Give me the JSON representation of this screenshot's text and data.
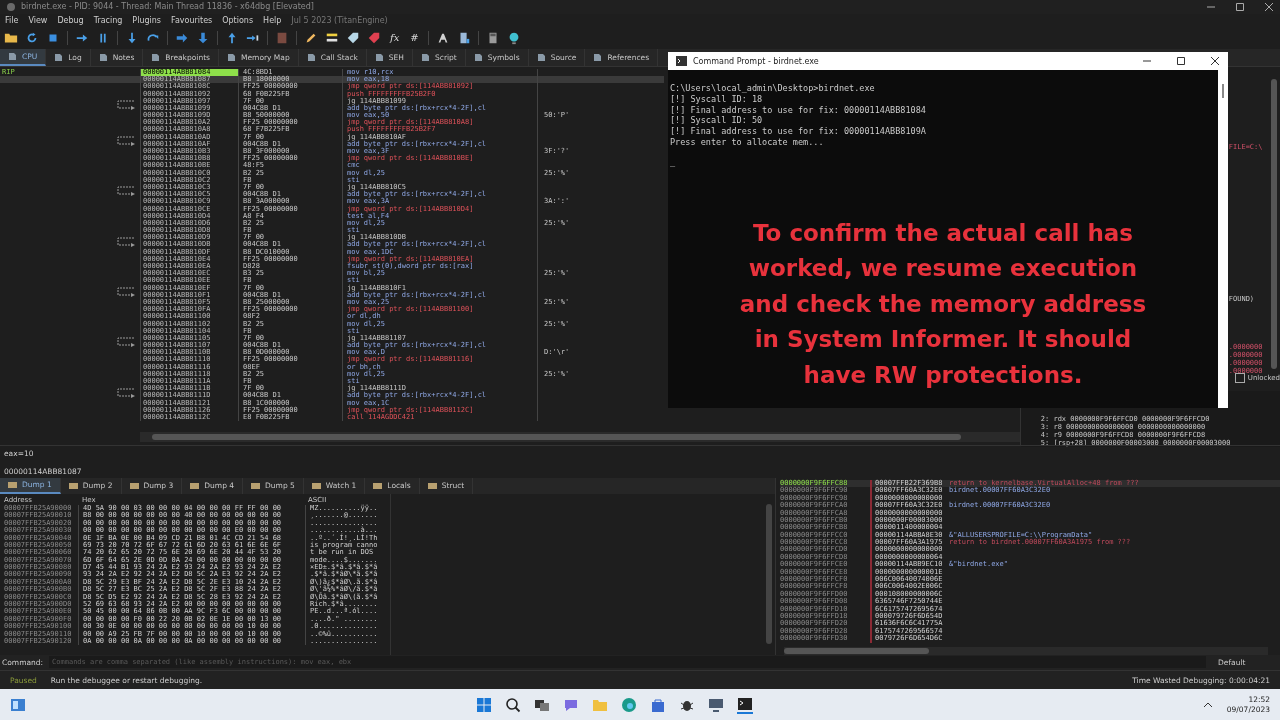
{
  "window": {
    "title": "birdnet.exe - PID: 9044 - Thread: Main Thread 11836 - x64dbg [Elevated]"
  },
  "menu": [
    "File",
    "View",
    "Debug",
    "Tracing",
    "Plugins",
    "Favourites",
    "Options",
    "Help"
  ],
  "build_info": "Jul 5 2023 (TitanEngine)",
  "toolbar": [
    {
      "kind": "folder"
    },
    {
      "kind": "restart"
    },
    {
      "kind": "stop"
    },
    {
      "kind": "separator"
    },
    {
      "kind": "run"
    },
    {
      "kind": "pause"
    },
    {
      "kind": "separator"
    },
    {
      "kind": "step-into"
    },
    {
      "kind": "step-over"
    },
    {
      "kind": "separator"
    },
    {
      "kind": "trace-into"
    },
    {
      "kind": "trace-over"
    },
    {
      "kind": "separator"
    },
    {
      "kind": "execute-till-return"
    },
    {
      "kind": "run-to-user"
    },
    {
      "kind": "separator"
    },
    {
      "kind": "brick"
    },
    {
      "kind": "separator"
    },
    {
      "kind": "pencil"
    },
    {
      "kind": "comment"
    },
    {
      "kind": "label"
    },
    {
      "kind": "bookmark"
    },
    {
      "kind": "text",
      "label": "fx"
    },
    {
      "kind": "text",
      "label": "#"
    },
    {
      "kind": "separator"
    },
    {
      "kind": "font"
    },
    {
      "kind": "device"
    },
    {
      "kind": "separator"
    },
    {
      "kind": "calculator"
    },
    {
      "kind": "globe"
    }
  ],
  "tabs": [
    {
      "label": "CPU",
      "selected": true
    },
    {
      "label": "Log",
      "selected": false
    },
    {
      "label": "Notes",
      "selected": false
    },
    {
      "label": "Breakpoints",
      "selected": false
    },
    {
      "label": "Memory Map",
      "selected": false
    },
    {
      "label": "Call Stack",
      "selected": false
    },
    {
      "label": "SEH",
      "selected": false
    },
    {
      "label": "Script",
      "selected": false
    },
    {
      "label": "Symbols",
      "selected": false
    },
    {
      "label": "Source",
      "selected": false
    },
    {
      "label": "References",
      "selected": false
    }
  ],
  "disassembly": {
    "rip_label": "RIP",
    "rows": [
      {
        "address": "00000114ABB81084",
        "bytes": "4C:8BD1",
        "instruction": "mov r10,rcx",
        "kind": "plain",
        "rip": true,
        "selected": false
      },
      {
        "address": "00000114ABB81087",
        "bytes": "B8 18000000",
        "instruction": "mov eax,18",
        "kind": "plain",
        "rip": false,
        "selected": true
      },
      {
        "address": "00000114ABB8108C",
        "bytes": "FF25 00000000",
        "instruction": "jmp qword ptr ds:[114ABB81092]",
        "kind": "branch",
        "rip": false,
        "selected": false
      },
      {
        "address": "00000114ABB81092",
        "bytes": "68 F0B225FB",
        "instruction": "push FFFFFFFFFB25B2F0",
        "kind": "branch",
        "rip": false,
        "selected": false
      },
      {
        "address": "00000114ABB81097",
        "bytes": "7F 00",
        "instruction": "jg 114ABB81099",
        "kind": "cond",
        "rip": false,
        "selected": false
      },
      {
        "address": "00000114ABB81099",
        "bytes": "004C8B D1",
        "instruction": "add byte ptr ds:[rbx+rcx*4-2F],cl",
        "kind": "plain",
        "rip": false,
        "selected": false
      },
      {
        "address": "00000114ABB8109D",
        "bytes": "B8 50000000",
        "instruction": "mov eax,50",
        "comment": "50:'P'",
        "kind": "plain",
        "rip": false,
        "selected": false
      },
      {
        "address": "00000114ABB810A2",
        "bytes": "FF25 00000000",
        "instruction": "jmp qword ptr ds:[114ABB810A8]",
        "kind": "branch",
        "rip": false,
        "selected": false
      },
      {
        "address": "00000114ABB810A8",
        "bytes": "68 F7B225FB",
        "instruction": "push FFFFFFFFFB25B2F7",
        "kind": "branch",
        "rip": false,
        "selected": false
      },
      {
        "address": "00000114ABB810AD",
        "bytes": "7F 00",
        "instruction": "jg 114ABB810AF",
        "kind": "cond",
        "rip": false,
        "selected": false
      },
      {
        "address": "00000114ABB810AF",
        "bytes": "004C8B D1",
        "instruction": "add byte ptr ds:[rbx+rcx*4-2F],cl",
        "kind": "plain",
        "rip": false,
        "selected": false
      },
      {
        "address": "00000114ABB810B3",
        "bytes": "B8 3F000000",
        "instruction": "mov eax,3F",
        "comment": "3F:'?'",
        "kind": "plain",
        "rip": false,
        "selected": false
      },
      {
        "address": "00000114ABB810B8",
        "bytes": "FF25 00000000",
        "instruction": "jmp qword ptr ds:[114ABB810BE]",
        "kind": "branch",
        "rip": false,
        "selected": false
      },
      {
        "address": "00000114ABB810BE",
        "bytes": "48:F5",
        "instruction": "cmc",
        "kind": "plain",
        "rip": false,
        "selected": false
      },
      {
        "address": "00000114ABB810C0",
        "bytes": "B2 25",
        "instruction": "mov dl,25",
        "comment": "25:'%'",
        "kind": "plain",
        "rip": false,
        "selected": false
      },
      {
        "address": "00000114ABB810C2",
        "bytes": "FB",
        "instruction": "sti",
        "kind": "plain",
        "rip": false,
        "selected": false
      },
      {
        "address": "00000114ABB810C3",
        "bytes": "7F 00",
        "instruction": "jg 114ABB810C5",
        "kind": "cond",
        "rip": false,
        "selected": false
      },
      {
        "address": "00000114ABB810C5",
        "bytes": "004C8B D1",
        "instruction": "add byte ptr ds:[rbx+rcx*4-2F],cl",
        "kind": "plain",
        "rip": false,
        "selected": false
      },
      {
        "address": "00000114ABB810C9",
        "bytes": "B8 3A000000",
        "instruction": "mov eax,3A",
        "comment": "3A:':'",
        "kind": "plain",
        "rip": false,
        "selected": false
      },
      {
        "address": "00000114ABB810CE",
        "bytes": "FF25 00000000",
        "instruction": "jmp qword ptr ds:[114ABB810D4]",
        "kind": "branch",
        "rip": false,
        "selected": false
      },
      {
        "address": "00000114ABB810D4",
        "bytes": "A8 F4",
        "instruction": "test al,F4",
        "kind": "plain",
        "rip": false,
        "selected": false
      },
      {
        "address": "00000114ABB810D6",
        "bytes": "B2 25",
        "instruction": "mov dl,25",
        "comment": "25:'%'",
        "kind": "plain",
        "rip": false,
        "selected": false
      },
      {
        "address": "00000114ABB810D8",
        "bytes": "FB",
        "instruction": "sti",
        "kind": "plain",
        "rip": false,
        "selected": false
      },
      {
        "address": "00000114ABB810D9",
        "bytes": "7F 00",
        "instruction": "jg 114ABB810DB",
        "kind": "cond",
        "rip": false,
        "selected": false
      },
      {
        "address": "00000114ABB810DB",
        "bytes": "004C8B D1",
        "instruction": "add byte ptr ds:[rbx+rcx*4-2F],cl",
        "kind": "plain",
        "rip": false,
        "selected": false
      },
      {
        "address": "00000114ABB810DF",
        "bytes": "B8 DC010000",
        "instruction": "mov eax,1DC",
        "kind": "plain",
        "rip": false,
        "selected": false
      },
      {
        "address": "00000114ABB810E4",
        "bytes": "FF25 00000000",
        "instruction": "jmp qword ptr ds:[114ABB810EA]",
        "kind": "branch",
        "rip": false,
        "selected": false
      },
      {
        "address": "00000114ABB810EA",
        "bytes": "D828",
        "instruction": "fsubr st(0),dword ptr ds:[rax]",
        "kind": "plain",
        "rip": false,
        "selected": false
      },
      {
        "address": "00000114ABB810EC",
        "bytes": "B3 25",
        "instruction": "mov bl,25",
        "comment": "25:'%'",
        "kind": "plain",
        "rip": false,
        "selected": false
      },
      {
        "address": "00000114ABB810EE",
        "bytes": "FB",
        "instruction": "sti",
        "kind": "plain",
        "rip": false,
        "selected": false
      },
      {
        "address": "00000114ABB810EF",
        "bytes": "7F 00",
        "instruction": "jg 114ABB810F1",
        "kind": "cond",
        "rip": false,
        "selected": false
      },
      {
        "address": "00000114ABB810F1",
        "bytes": "004C8B D1",
        "instruction": "add byte ptr ds:[rbx+rcx*4-2F],cl",
        "kind": "plain",
        "rip": false,
        "selected": false
      },
      {
        "address": "00000114ABB810F5",
        "bytes": "B8 25000000",
        "instruction": "mov eax,25",
        "comment": "25:'%'",
        "kind": "plain",
        "rip": false,
        "selected": false
      },
      {
        "address": "00000114ABB810FA",
        "bytes": "FF25 00000000",
        "instruction": "jmp qword ptr ds:[114ABB81100]",
        "kind": "branch",
        "rip": false,
        "selected": false
      },
      {
        "address": "00000114ABB81100",
        "bytes": "08F2",
        "instruction": "or dl,dh",
        "kind": "plain",
        "rip": false,
        "selected": false
      },
      {
        "address": "00000114ABB81102",
        "bytes": "B2 25",
        "instruction": "mov dl,25",
        "comment": "25:'%'",
        "kind": "plain",
        "rip": false,
        "selected": false
      },
      {
        "address": "00000114ABB81104",
        "bytes": "FB",
        "instruction": "sti",
        "kind": "plain",
        "rip": false,
        "selected": false
      },
      {
        "address": "00000114ABB81105",
        "bytes": "7F 00",
        "instruction": "jg 114ABB81107",
        "kind": "cond",
        "rip": false,
        "selected": false
      },
      {
        "address": "00000114ABB81107",
        "bytes": "004C8B D1",
        "instruction": "add byte ptr ds:[rbx+rcx*4-2F],cl",
        "kind": "plain",
        "rip": false,
        "selected": false
      },
      {
        "address": "00000114ABB8110B",
        "bytes": "B8 0D000000",
        "instruction": "mov eax,D",
        "comment": "D:'\\r'",
        "kind": "plain",
        "rip": false,
        "selected": false
      },
      {
        "address": "00000114ABB81110",
        "bytes": "FF25 00000000",
        "instruction": "jmp qword ptr ds:[114ABB81116]",
        "kind": "branch",
        "rip": false,
        "selected": false
      },
      {
        "address": "00000114ABB81116",
        "bytes": "08EF",
        "instruction": "or bh,ch",
        "kind": "plain",
        "rip": false,
        "selected": false
      },
      {
        "address": "00000114ABB81118",
        "bytes": "B2 25",
        "instruction": "mov dl,25",
        "comment": "25:'%'",
        "kind": "plain",
        "rip": false,
        "selected": false
      },
      {
        "address": "00000114ABB8111A",
        "bytes": "FB",
        "instruction": "sti",
        "kind": "plain",
        "rip": false,
        "selected": false
      },
      {
        "address": "00000114ABB8111B",
        "bytes": "7F 00",
        "instruction": "jg 114ABB8111D",
        "kind": "cond",
        "rip": false,
        "selected": false
      },
      {
        "address": "00000114ABB8111D",
        "bytes": "004C8B D1",
        "instruction": "add byte ptr ds:[rbx+rcx*4-2F],cl",
        "kind": "plain",
        "rip": false,
        "selected": false
      },
      {
        "address": "00000114ABB81121",
        "bytes": "B8 1C000000",
        "instruction": "mov eax,1C",
        "kind": "plain",
        "rip": false,
        "selected": false
      },
      {
        "address": "00000114ABB81126",
        "bytes": "FF25 00000000",
        "instruction": "jmp qword ptr ds:[114ABB8112C]",
        "kind": "branch",
        "rip": false,
        "selected": false
      },
      {
        "address": "00000114ABB8112C",
        "bytes": "E8 F0B225FB",
        "instruction": "call 114AGDDC421",
        "kind": "branch",
        "rip": false,
        "selected": false
      }
    ]
  },
  "registers": {
    "texts": [
      {
        "text": "FILE=C:\\",
        "kind": "red"
      },
      {
        "text": "FOUND)",
        "kind": "plain"
      },
      {
        "text": ".0000000",
        "kind": "red"
      },
      {
        "text": ".0000000",
        "kind": "red"
      },
      {
        "text": ".0000000",
        "kind": "red"
      },
      {
        "text": ".0000000",
        "kind": "red"
      }
    ],
    "lock_label": "Unlocked",
    "locked": false
  },
  "call_arguments": [
    "2: rdx 0000000F9F6FFCD0 0000000F9F6FFCD0",
    "3: r8 0000000000000000 0000000000000000",
    "4: r9 0000000F9F6FFCD8 0000000F9F6FFCD8",
    "5: [rsp+28] 0000000F00003000 0000000F00003000"
  ],
  "info_pane": [
    "eax=10",
    "00000114ABB81087"
  ],
  "dump_tabs": [
    {
      "label": "Dump 1",
      "selected": true
    },
    {
      "label": "Dump 2",
      "selected": false
    },
    {
      "label": "Dump 3",
      "selected": false
    },
    {
      "label": "Dump 4",
      "selected": false
    },
    {
      "label": "Dump 5",
      "selected": false
    },
    {
      "label": "Watch 1",
      "selected": false
    },
    {
      "label": "Locals",
      "selected": false
    },
    {
      "label": "Struct",
      "selected": false
    }
  ],
  "dump": {
    "columns": [
      "Address",
      "Hex",
      "ASCII"
    ],
    "rows": [
      {
        "address": "00007FFB25A90000",
        "hex": "4D 5A 90 00 03 00 00 00 04 00 00 00 FF FF 00 00",
        "ascii": "MZ..........ÿÿ.."
      },
      {
        "address": "00007FFB25A90010",
        "hex": "B8 00 00 00 00 00 00 00 40 00 00 00 00 00 00 00",
        "ascii": "¸.......@......."
      },
      {
        "address": "00007FFB25A90020",
        "hex": "00 00 00 00 00 00 00 00 00 00 00 00 00 00 00 00",
        "ascii": "................"
      },
      {
        "address": "00007FFB25A90030",
        "hex": "00 00 00 00 00 00 00 00 00 00 00 00 E0 00 00 00",
        "ascii": "............à..."
      },
      {
        "address": "00007FFB25A90040",
        "hex": "0E 1F BA 0E 00 B4 09 CD 21 B8 01 4C CD 21 54 68",
        "ascii": "..º..´.Í!¸.LÍ!Th"
      },
      {
        "address": "00007FFB25A90050",
        "hex": "69 73 20 70 72 6F 67 72 61 6D 20 63 61 6E 6E 6F",
        "ascii": "is program canno"
      },
      {
        "address": "00007FFB25A90060",
        "hex": "74 20 62 65 20 72 75 6E 20 69 6E 20 44 4F 53 20",
        "ascii": "t be run in DOS "
      },
      {
        "address": "00007FFB25A90070",
        "hex": "6D 6F 64 65 2E 0D 0D 0A 24 00 00 00 00 00 00 00",
        "ascii": "mode....$......."
      },
      {
        "address": "00007FFB25A90080",
        "hex": "D7 45 44 B1 93 24 2A E2 93 24 2A E2 93 24 2A E2",
        "ascii": "×ED±.$*â.$*â.$*â"
      },
      {
        "address": "00007FFB25A90090",
        "hex": "93 24 2A E2 92 24 2A E2 D8 5C 2A E3 92 24 2A E2",
        "ascii": ".$*â.$*âØ\\*ã.$*â"
      },
      {
        "address": "00007FFB25A900A0",
        "hex": "D8 5C 29 E3 BF 24 2A E2 D8 5C 2E E3 10 24 2A E2",
        "ascii": "Ø\\)ã¿$*âØ\\.ã.$*â"
      },
      {
        "address": "00007FFB25A900B0",
        "hex": "D8 5C 27 E3 BC 25 2A E2 D8 5C 2F E3 88 24 2A E2",
        "ascii": "Ø\\'ã¼%*âØ\\/ã.$*â"
      },
      {
        "address": "00007FFB25A900C0",
        "hex": "D8 5C D5 E2 92 24 2A E2 D8 5C 28 E3 92 24 2A E2",
        "ascii": "Ø\\Õâ.$*âØ\\(ã.$*â"
      },
      {
        "address": "00007FFB25A900D0",
        "hex": "52 69 63 68 93 24 2A E2 00 00 00 00 00 00 00 00",
        "ascii": "Rich.$*â........"
      },
      {
        "address": "00007FFB25A900E0",
        "hex": "50 45 00 00 64 86 0B 00 AA 9C F3 6C 00 00 00 00",
        "ascii": "PE..d...ª.ól...."
      },
      {
        "address": "00007FFB25A900F0",
        "hex": "00 00 00 00 F0 00 22 20 0B 02 0E 1E 00 00 13 00",
        "ascii": "....ð.\" ........"
      },
      {
        "address": "00007FFB25A90100",
        "hex": "00 30 0E 00 00 00 00 00 00 00 00 00 00 10 00 00",
        "ascii": ".0.............."
      },
      {
        "address": "00007FFB25A90110",
        "hex": "00 00 A9 25 FB 7F 00 00 00 10 00 00 00 10 00 00",
        "ascii": "..©%û..........."
      },
      {
        "address": "00007FFB25A90120",
        "hex": "0A 00 00 00 0A 00 00 00 0A 00 00 00 00 00 00 00",
        "ascii": "................"
      }
    ]
  },
  "stack": [
    {
      "address": "0000000F9F6FFC88",
      "value": "00007FFB22F369B8",
      "comment": "return to kernelbase.VirtualAlloc+48 from ???",
      "kind": "return",
      "selected": true
    },
    {
      "address": "0000000F9F6FFC90",
      "value": "00007FF60A3C32E0",
      "comment": "birdnet.00007FF60A3C32E0",
      "kind": "plain",
      "selected": false
    },
    {
      "address": "0000000F9F6FFC98",
      "value": "0000000000000000",
      "selected": false
    },
    {
      "address": "0000000F9F6FFCA0",
      "value": "00007FF60A3C32E0",
      "comment": "birdnet.00007FF60A3C32E0",
      "kind": "plain",
      "selected": false
    },
    {
      "address": "0000000F9F6FFCA8",
      "value": "0000000000000000",
      "selected": false
    },
    {
      "address": "0000000F9F6FFCB0",
      "value": "0000000F00003000",
      "selected": false
    },
    {
      "address": "0000000F9F6FFCB8",
      "value": "0000011400000004",
      "selected": false
    },
    {
      "address": "0000000F9F6FFCC0",
      "value": "00000114ABBA8E30",
      "comment": "&\"ALLUSERSPROFILE=C:\\\\ProgramData\"",
      "kind": "plain",
      "selected": false
    },
    {
      "address": "0000000F9F6FFCC8",
      "value": "00007FF60A3A1975",
      "comment": "return to birdnet.00007FF60A3A1975 from ???",
      "kind": "return",
      "selected": false
    },
    {
      "address": "0000000F9F6FFCD0",
      "value": "0000000000000000",
      "selected": false
    },
    {
      "address": "0000000F9F6FFCD8",
      "value": "0000000000000064",
      "selected": false
    },
    {
      "address": "0000000F9F6FFCE0",
      "value": "00000114ABB9EC10",
      "comment": "&\"birdnet.exe\"",
      "kind": "plain",
      "selected": false
    },
    {
      "address": "0000000F9F6FFCE8",
      "value": "000000000000001E",
      "selected": false
    },
    {
      "address": "0000000F9F6FFCF0",
      "value": "006C00640074006E",
      "selected": false
    },
    {
      "address": "0000000F9F6FFCF8",
      "value": "006C0064002E006C",
      "selected": false
    },
    {
      "address": "0000000F9F6FFD00",
      "value": "000108000000006C",
      "selected": false
    },
    {
      "address": "0000000F9F6FFD08",
      "value": "6365746F7250744E",
      "selected": false
    },
    {
      "address": "0000000F9F6FFD10",
      "value": "6C61757472695674",
      "selected": false
    },
    {
      "address": "0000000F9F6FFD18",
      "value": "000079726F6D654D",
      "selected": false
    },
    {
      "address": "0000000F9F6FFD20",
      "value": "61636F6C6C41775A",
      "selected": false
    },
    {
      "address": "0000000F9F6FFD28",
      "value": "6175747269566574",
      "selected": false
    },
    {
      "address": "0000000F9F6FFD30",
      "value": "0079726F6D654D6C",
      "selected": false
    }
  ],
  "command_bar": {
    "label": "Command:",
    "placeholder": "Commands are comma separated (like assembly instructions): mov eax, ebx",
    "mode": "Default"
  },
  "status_bar": {
    "state": "Paused",
    "message": "Run the debuggee or restart debugging.",
    "time_wasted": "Time Wasted Debugging: 0:00:04:21"
  },
  "console": {
    "title": "Command Prompt - birdnet.exe",
    "lines": [
      "C:\\Users\\local_admin\\Desktop>birdnet.exe",
      "[!] Syscall ID: 18",
      "[!] Final address to use for fix: 00000114ABB81084",
      "[!] Syscall ID: 50",
      "[!] Final address to use for fix: 00000114ABB8109A",
      "Press enter to allocate mem..."
    ],
    "cursor": "_"
  },
  "caption": "To confirm the actual call has worked, we resume execution and check the memory address in System Informer. It should have RW protections.",
  "taskbar": {
    "time": "12:52",
    "date": "09/07/2023"
  }
}
